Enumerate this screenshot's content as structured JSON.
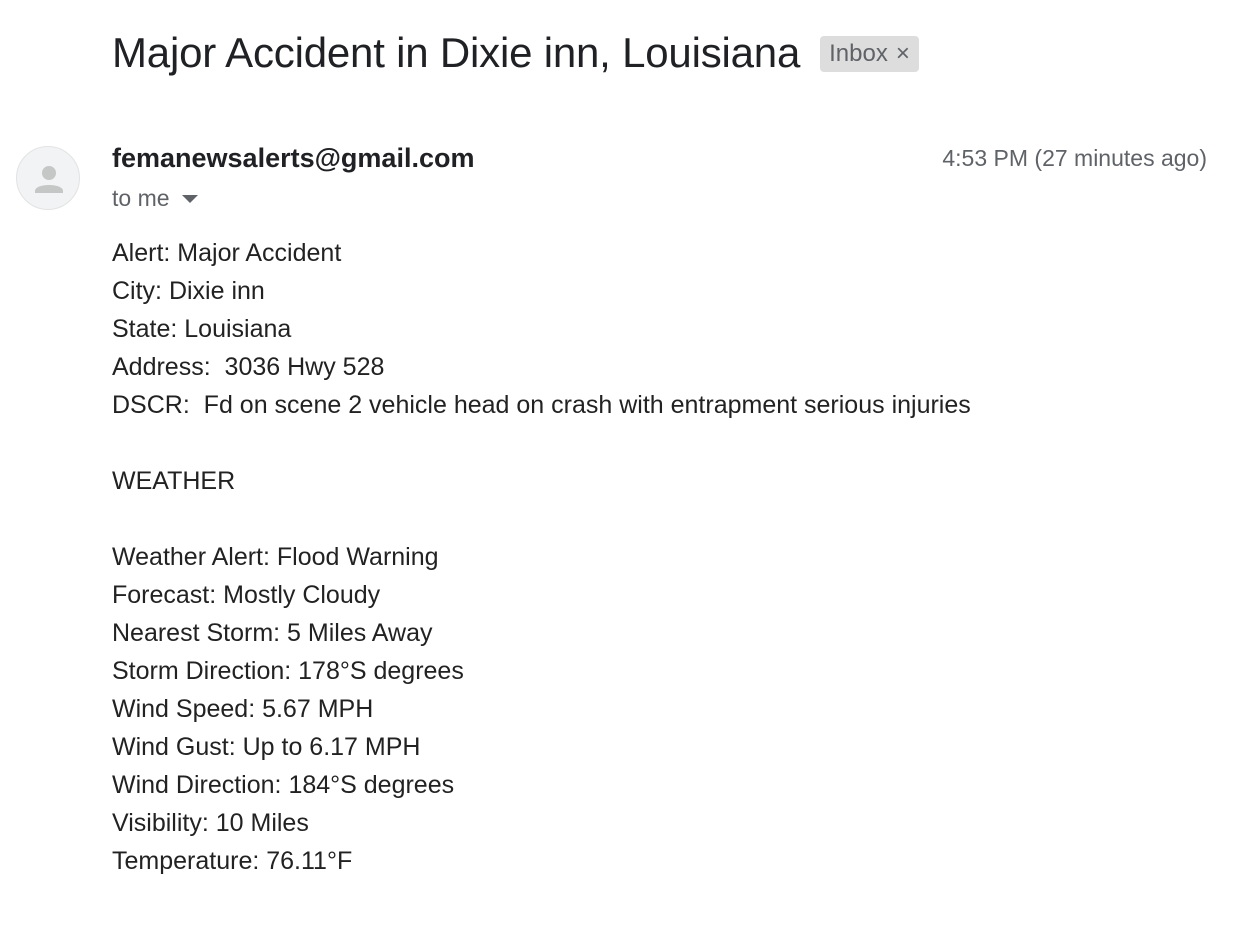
{
  "email": {
    "subject": "Major Accident in Dixie inn, Louisiana",
    "label": "Inbox",
    "label_close": "×",
    "sender": "femanewsalerts@gmail.com",
    "timestamp": "4:53 PM (27 minutes ago)",
    "recipient": "to me",
    "body_lines": [
      "Alert: Major Accident",
      "City: Dixie inn",
      "State: Louisiana",
      "Address:  3036 Hwy 528",
      "DSCR:  Fd on scene 2 vehicle head on crash with entrapment serious injuries",
      "",
      "WEATHER",
      "",
      "Weather Alert: Flood Warning",
      "Forecast: Mostly Cloudy",
      "Nearest Storm: 5 Miles Away",
      "Storm Direction: 178°S degrees",
      "Wind Speed: 5.67 MPH",
      "Wind Gust: Up to 6.17 MPH",
      "Wind Direction: 184°S degrees",
      "Visibility: 10 Miles",
      "Temperature: 76.11°F"
    ]
  },
  "icons": {
    "avatar": "person-icon",
    "recipient_details": "caret-down-icon",
    "label_remove": "close-icon"
  },
  "colors": {
    "label_chip_bg": "#dddddd",
    "secondary_text": "#5f6368",
    "primary_text": "#202124"
  }
}
